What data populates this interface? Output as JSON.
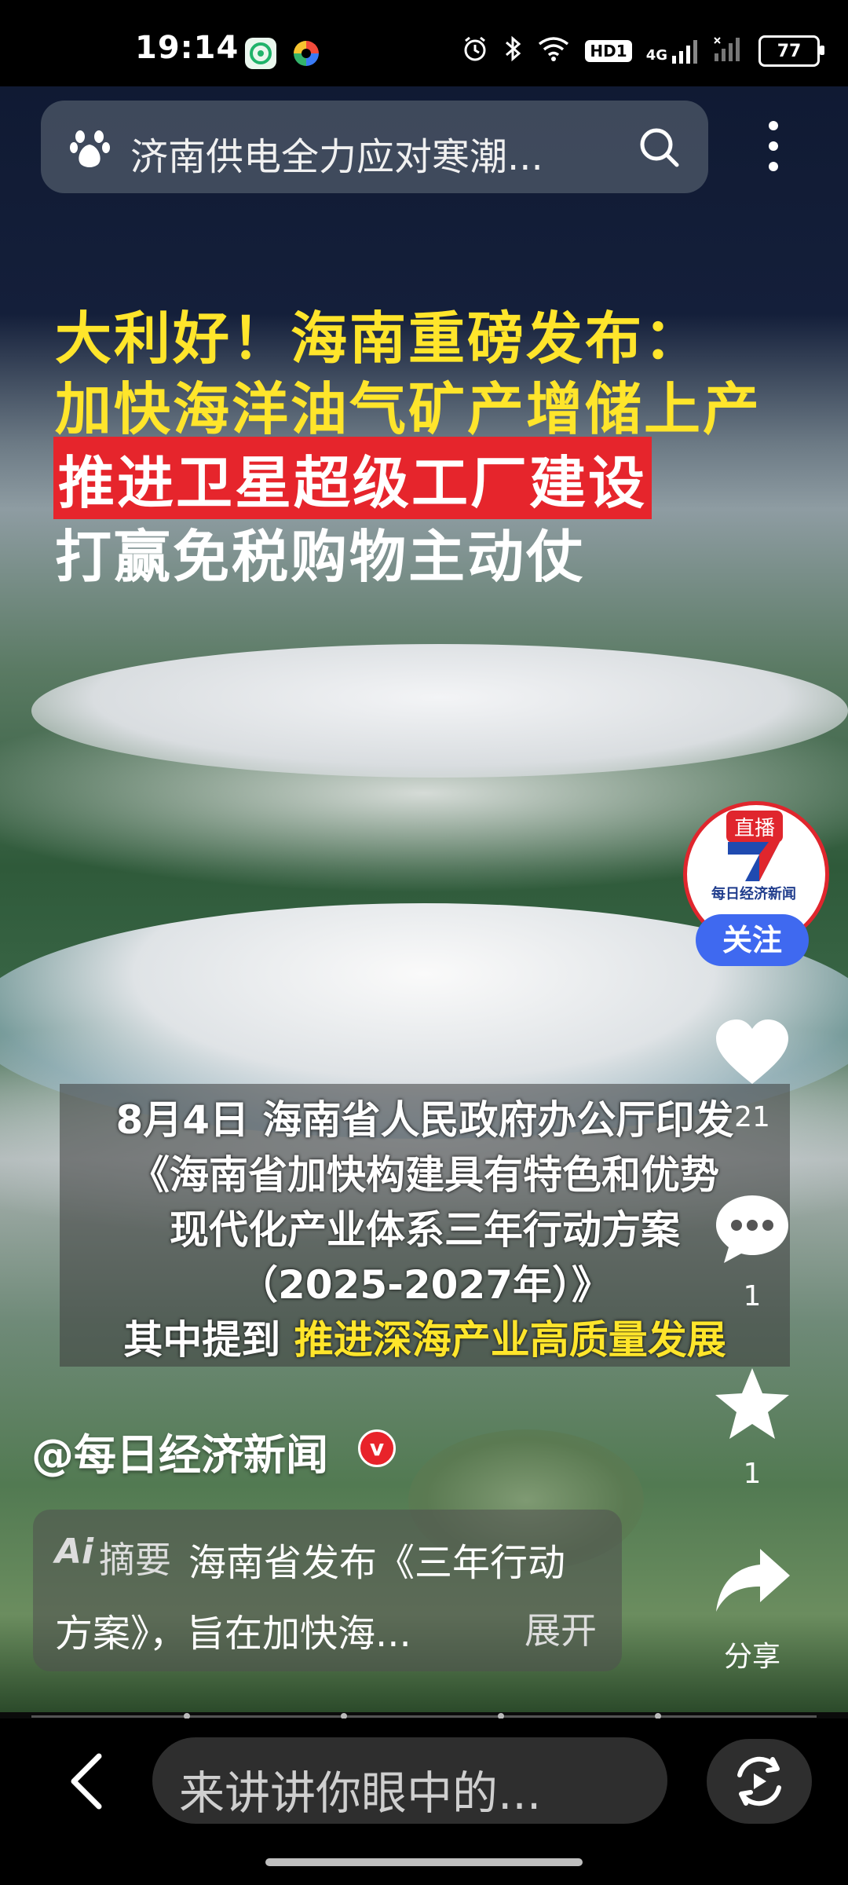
{
  "status_bar": {
    "time": "19:14",
    "battery": "77",
    "icons": [
      "app-green-icon",
      "app-multicolor-icon",
      "alarm-icon",
      "bluetooth-icon",
      "wifi-icon",
      "hd-icon",
      "4g-signal-icon",
      "signal-icon",
      "battery-icon"
    ],
    "hd_label": "HD1",
    "net_label": "4G"
  },
  "search": {
    "query": "济南供电全力应对寒潮...",
    "icons": [
      "baidu-paw-icon",
      "search-icon",
      "more-vertical-icon"
    ]
  },
  "video": {
    "headline": {
      "line1": "大利好！海南重磅发布：",
      "line2": "加快海洋油气矿产增储上产",
      "line3": "推进卫星超级工厂建设",
      "line4": "打赢免税购物主动仗"
    },
    "caption": {
      "line1": "8月4日 海南省人民政府办公厅印发",
      "line2": "《海南省加快构建具有特色和优势",
      "line3": "现代化产业体系三年行动方案",
      "line4": "（2025-2027年）》",
      "line5_prefix": "其中提到 ",
      "line5_highlight": "推进深海产业高质量发展"
    },
    "accent_yellow": "#ffe52b",
    "accent_red": "#e6252c"
  },
  "side": {
    "live_tag": "直播",
    "avatar_name": "每日经济新闻",
    "follow_label": "关注",
    "like_count": "21",
    "comment_count": "1",
    "favorite_count": "1",
    "share_label": "分享",
    "icons": [
      "heart-icon",
      "comment-icon",
      "star-icon",
      "share-icon"
    ]
  },
  "author": {
    "name": "@每日经济新闻",
    "verified_mark": "v"
  },
  "summary": {
    "ai_logo": "Ai",
    "label": "摘要",
    "line1": "海南省发布《三年行动",
    "line2": "方案》，旨在加快海...",
    "expand_label": "展开"
  },
  "bottom": {
    "comment_placeholder": "来讲讲你眼中的...",
    "icons": [
      "back-arrow-icon",
      "switch-play-icon"
    ]
  }
}
